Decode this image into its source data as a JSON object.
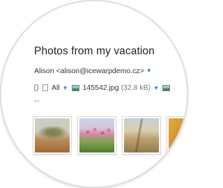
{
  "message": {
    "subject": "Photos from my vacation",
    "sender": "Alison <alison@icewarpdemo.cz>",
    "attachments_filter": "All",
    "attachment_name": "145542.jpg",
    "attachment_size": "(32.8 kB)",
    "separator": "--"
  },
  "icons": {
    "paperclip": "paperclip-icon",
    "dropdown": "chevron-down-icon",
    "image": "image-file-icon"
  },
  "colors": {
    "accent": "#1f78c8",
    "text": "#222222"
  }
}
